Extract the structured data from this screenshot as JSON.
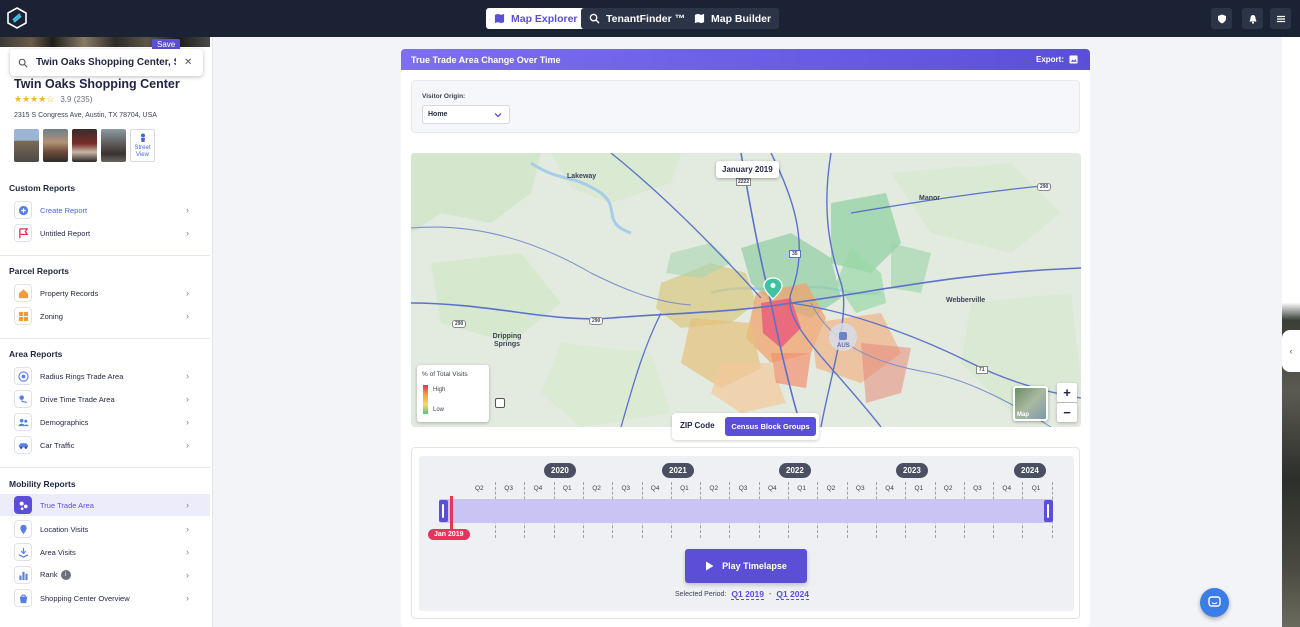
{
  "topbar": {
    "tabs": [
      {
        "label": "Map Explorer",
        "icon": "map-icon",
        "active": true
      },
      {
        "label": "TenantFinder ™",
        "icon": "search-icon",
        "active": false
      },
      {
        "label": "Map Builder",
        "icon": "map-builder-icon",
        "active": false
      }
    ],
    "right_icons": [
      "shield-icon",
      "bell-icon",
      "menu-icon"
    ]
  },
  "sidebar": {
    "save_label": "Save",
    "search": {
      "value": "Twin Oaks Shopping Center, S...",
      "placeholder": "Search"
    },
    "place": {
      "title": "Twin Oaks Shopping Center",
      "stars": "★★★★☆",
      "rating": "3.9 (235)",
      "address": "2315 S Congress Ave, Austin, TX 78704, USA",
      "street_view_label_1": "Street",
      "street_view_label_2": "View"
    },
    "sections": [
      {
        "title": "Custom Reports",
        "items": [
          {
            "label": "Create Report",
            "icon": "plus-circle-icon"
          },
          {
            "label": "Untitled Report",
            "icon": "flag-icon"
          }
        ]
      },
      {
        "title": "Parcel Reports",
        "items": [
          {
            "label": "Property Records",
            "icon": "house-icon"
          },
          {
            "label": "Zoning",
            "icon": "zoning-icon"
          }
        ]
      },
      {
        "title": "Area Reports",
        "items": [
          {
            "label": "Radius Rings Trade Area",
            "icon": "radius-icon"
          },
          {
            "label": "Drive Time Trade Area",
            "icon": "drive-icon"
          },
          {
            "label": "Demographics",
            "icon": "people-icon"
          },
          {
            "label": "Car Traffic",
            "icon": "car-icon"
          }
        ]
      },
      {
        "title": "Mobility Reports",
        "items": [
          {
            "label": "True Trade Area",
            "icon": "trade-area-icon",
            "selected": true
          },
          {
            "label": "Location Visits",
            "icon": "location-visits-icon"
          },
          {
            "label": "Area Visits",
            "icon": "area-visits-icon"
          },
          {
            "label": "Rank",
            "icon": "rank-icon",
            "badge": "i"
          },
          {
            "label": "Shopping Center Overview",
            "icon": "shopping-center-icon"
          }
        ]
      }
    ]
  },
  "panel": {
    "title": "True Trade Area Change Over Time",
    "export_label": "Export:",
    "visitor_origin_label": "Visitor Origin:",
    "visitor_origin_value": "Home",
    "map": {
      "date_bubble": "January 2019",
      "legend_title": "% of Total Visits",
      "legend_high": "High",
      "legend_low": "Low",
      "map_type_label": "Map",
      "zoom_in": "+",
      "zoom_out": "−",
      "labels": [
        "Lakeway",
        "Manor",
        "Dripping Springs",
        "Webberville",
        "AUS"
      ],
      "road_shields": [
        "2222",
        "290",
        "71",
        "290",
        "290",
        "35"
      ]
    },
    "geo_toggle": {
      "zip": "ZIP Code",
      "cbg": "Census Block Groups",
      "selected": "Census Block Groups"
    },
    "timeline": {
      "years": [
        "2020",
        "2021",
        "2022",
        "2023",
        "2024"
      ],
      "quarters": [
        "Q2",
        "Q3",
        "Q4",
        "Q1",
        "Q2",
        "Q3",
        "Q4",
        "Q1",
        "Q2",
        "Q3",
        "Q4",
        "Q1",
        "Q2",
        "Q3",
        "Q4",
        "Q1",
        "Q2",
        "Q3",
        "Q4",
        "Q1"
      ],
      "current_badge": "Jan 2019",
      "play_label": "Play Timelapse",
      "selected_period_label": "Selected Period:",
      "period_start": "Q1 2019",
      "period_sep": "-",
      "period_end": "Q1 2024"
    }
  },
  "colors": {
    "accent": "#5b4fd8",
    "topbar": "#1b2234",
    "playhead": "#e8335c",
    "chat": "#3a7ce8"
  }
}
